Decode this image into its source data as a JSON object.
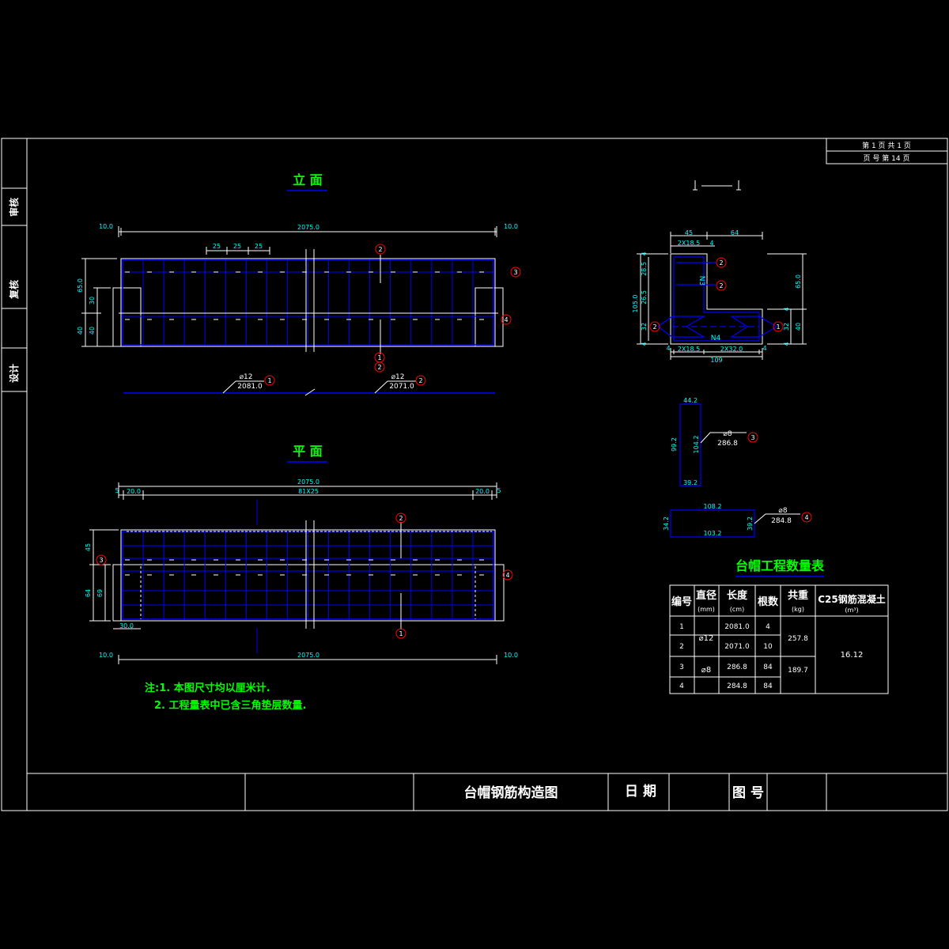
{
  "side_labels": [
    "审核",
    "复核",
    "设计"
  ],
  "title_block_top": [
    "第 1 页 共 1 页",
    "页 号 第 14 页"
  ],
  "elevation": {
    "title": "立 面",
    "dims_top": [
      "10.0",
      "2075.0",
      "10.0"
    ],
    "spacing": [
      "25",
      "25",
      "25"
    ],
    "dims_left": [
      "65.0",
      "30",
      "40",
      "40"
    ],
    "bar_lines": [
      {
        "symbol": "⌀12",
        "length": "2081.0",
        "mark": "1"
      },
      {
        "symbol": "⌀12",
        "length": "2071.0",
        "mark": "2"
      }
    ]
  },
  "plan": {
    "title": "平 面",
    "dims_top": [
      "2075.0",
      "5",
      "20.0",
      "81X25",
      "20.0",
      "5"
    ],
    "dims_left": [
      "45",
      "64",
      "69"
    ],
    "dim_bottom_left": "30.0",
    "dims_bottom": [
      "10.0",
      "2075.0",
      "10.0"
    ]
  },
  "marks": [
    "1",
    "2",
    "3",
    "4"
  ],
  "section": {
    "dims_top": [
      "45",
      "64"
    ],
    "dims_inner_top": [
      "2X18.5",
      "4"
    ],
    "dims_left": [
      "4",
      "28.5",
      "26.5",
      "105.0",
      "32",
      "4"
    ],
    "dims_right": [
      "65.0",
      "4",
      "32",
      "40",
      "4"
    ],
    "dims_bottom": [
      "4",
      "2X18.5",
      "2X32.0",
      "4",
      "109"
    ],
    "labels": [
      "N3",
      "N4"
    ]
  },
  "bar3": {
    "dims": [
      "44.2",
      "99.2",
      "104.2",
      "39.2"
    ],
    "symbol": "⌀8",
    "length": "286.8",
    "mark": "3"
  },
  "bar4": {
    "dims": [
      "108.2",
      "34.2",
      "39.2",
      "103.2"
    ],
    "symbol": "⌀8",
    "length": "284.8",
    "mark": "4"
  },
  "notes": [
    "注:1. 本图尺寸均以厘米计.",
    "2. 工程量表中已含三角垫层数量."
  ],
  "table": {
    "title": "台帽工程数量表",
    "headers": [
      "编号",
      "直径",
      "(mm)",
      "长度",
      "(cm)",
      "根数",
      "共重",
      "(kg)",
      "C25钢筋混凝土",
      "(m³)"
    ],
    "rows": [
      {
        "no": "1",
        "length": "2081.0",
        "count": "4"
      },
      {
        "no": "2",
        "length": "2071.0",
        "count": "10"
      },
      {
        "no": "3",
        "length": "286.8",
        "count": "84"
      },
      {
        "no": "4",
        "length": "284.8",
        "count": "84"
      }
    ],
    "dia_12": "⌀12",
    "dia_8": "⌀8",
    "weight_12": "257.8",
    "weight_8": "189.7",
    "concrete": "16.12"
  },
  "title_block": {
    "drawing_title": "台帽钢筋构造图",
    "date_label": "日 期",
    "number_label": "图 号"
  },
  "colors": {
    "frame": "#ffffff",
    "steel": "#0000ff",
    "dimension": "#00ffff",
    "title": "#00ff00",
    "mark_circle": "#ff0000"
  }
}
